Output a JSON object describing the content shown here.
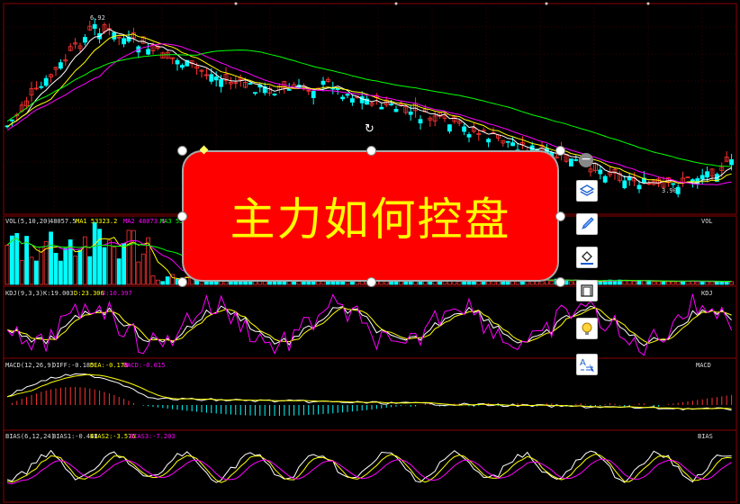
{
  "price_panel": {
    "high_label": "6.92",
    "low_label": "3.90"
  },
  "vol_panel": {
    "name": "VOL(5,10,20)",
    "value": "48057.5",
    "ma1": "MA1 53323.2",
    "ma2": "MA2 48073.6",
    "ma3": "MA3 53794.",
    "right_tag": "VOL"
  },
  "kdj_panel": {
    "name": "KDJ(9,3,3)",
    "k": "K:19.003",
    "d": "D:23.306",
    "j": "J:10.397",
    "right_tag": "KDJ"
  },
  "macd_panel": {
    "name": "MACD(12,26,9)",
    "diff": "DIFF:-0.185",
    "dea": "DEA:-0.178",
    "macd": "MACD:-0.015",
    "right_tag": "MACD"
  },
  "bias_panel": {
    "name": "BIAS(6,12,24)",
    "bias1": "BIAS1:-0.448",
    "bias2": "BIAS2:-3.576",
    "bias3": "BIAS3:-7.203",
    "right_tag": "BIAS"
  },
  "banner": {
    "text": "主力如何控盘"
  },
  "toolbar": {
    "tools": [
      "layers-icon",
      "brush-icon",
      "fill-bucket-icon",
      "frame-icon",
      "lightbulb-icon",
      "text-style-icon"
    ]
  },
  "colors": {
    "up": "#ff3232",
    "down": "#00ffff",
    "ma5": "#ffffff",
    "ma10": "#ffff00",
    "ma20": "#ff00ff",
    "ma60": "#00ff00",
    "banner_bg": "#ff0000",
    "banner_text": "#ffff00"
  }
}
